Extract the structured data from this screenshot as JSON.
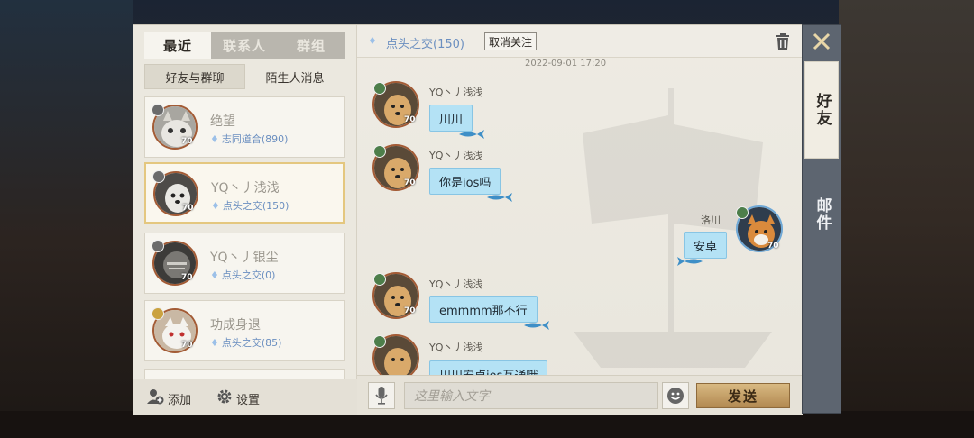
{
  "left_panel": {
    "tabs": [
      {
        "label": "最近",
        "active": true
      },
      {
        "label": "联系人",
        "active": false
      },
      {
        "label": "群组",
        "active": false
      }
    ],
    "subtabs": [
      {
        "label": "好友与群聊",
        "active": true
      },
      {
        "label": "陌生人消息",
        "active": false
      }
    ],
    "contacts": [
      {
        "name": "绝望",
        "relation": "志同道合",
        "intimacy": "(890)",
        "level": "70",
        "selected": false
      },
      {
        "name": "YQ丶丿浅浅",
        "relation": "点头之交",
        "intimacy": "(150)",
        "level": "70",
        "selected": true
      },
      {
        "name": "YQ丶丿银尘",
        "relation": "点头之交",
        "intimacy": "(0)",
        "level": "70",
        "selected": false
      },
      {
        "name": "功成身退",
        "relation": "点头之交",
        "intimacy": "(85)",
        "level": "70",
        "selected": false
      }
    ],
    "footer": {
      "add_label": "添加",
      "settings_label": "设置"
    }
  },
  "chat": {
    "header": {
      "relation": "点头之交",
      "intimacy": "(150)",
      "unfollow_label": "取消关注"
    },
    "timestamp": "2022-09-01 17:20",
    "messages": [
      {
        "sender": "YQ丶丿浅浅",
        "text": "川川",
        "side": "left",
        "level": "70"
      },
      {
        "sender": "YQ丶丿浅浅",
        "text": "你是ios吗",
        "side": "left",
        "level": "70"
      },
      {
        "sender": "洛川",
        "text": "安卓",
        "side": "right",
        "level": "70"
      },
      {
        "sender": "YQ丶丿浅浅",
        "text": "emmmm那不行",
        "side": "left",
        "level": "70"
      },
      {
        "sender": "YQ丶丿浅浅",
        "text": "川川安卓ios互通哦",
        "side": "left",
        "level": "70"
      }
    ],
    "input": {
      "placeholder": "这里输入文字",
      "send_label": "发送"
    }
  },
  "side_tabs": [
    {
      "label": "好友",
      "active": true
    },
    {
      "label": "邮件",
      "active": false
    }
  ],
  "colors": {
    "accent_gold": "#b28951",
    "bubble_blue": "#b4e2f5",
    "relation_blue": "#6b8fc0",
    "selected_border": "#e4c77f"
  }
}
